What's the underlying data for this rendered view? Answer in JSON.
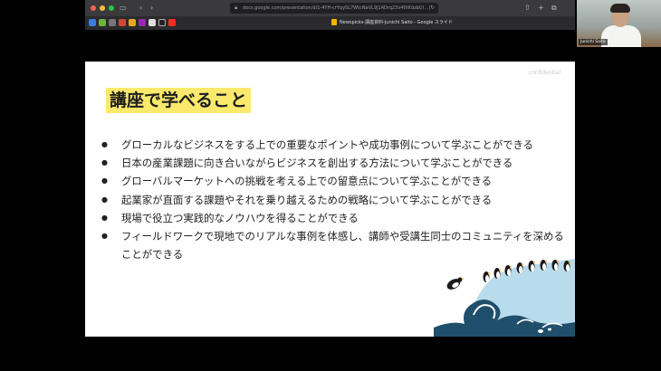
{
  "browser": {
    "url": "docs.google.com/presentation/d/1-4YH-crYqySL7WtcNaVL9j1ADrq23v4fXKdzbU(...)",
    "tab_title": "Newspicks-講座資料-Junichi Saito - Google スライド"
  },
  "video": {
    "participant_name": "Junichi Saito"
  },
  "slide": {
    "confidential": "confidential",
    "title": "講座で学べること",
    "bullets": [
      "グローカルなビジネスをする上での重要なポイントや成功事例について学ぶことができる",
      "日本の産業課題に向き合いながらビジネスを創出する方法について学ぶことができる",
      "グローバルマーケットへの挑戦を考える上での留意点について学ぶことができる",
      "起業家が直面する課題やそれを乗り越えるための戦略について学ぶことができる",
      "現場で役立つ実践的なノウハウを得ることができる",
      "フィールドワークで現地でのリアルな事例を体感し、講師や受講生同士のコミュニティを深めることができる"
    ]
  },
  "icons": [
    "sidebar-icon",
    "back-icon",
    "forward-icon",
    "lock-icon",
    "reload-icon",
    "share-icon",
    "new-tab-icon",
    "tabs-overview-icon",
    "penguins-on-wave-illustration"
  ],
  "colors": {
    "title_highlight": "#fbe96d",
    "wave_dark": "#1f4f6b",
    "iceberg": "#b9dcec"
  }
}
